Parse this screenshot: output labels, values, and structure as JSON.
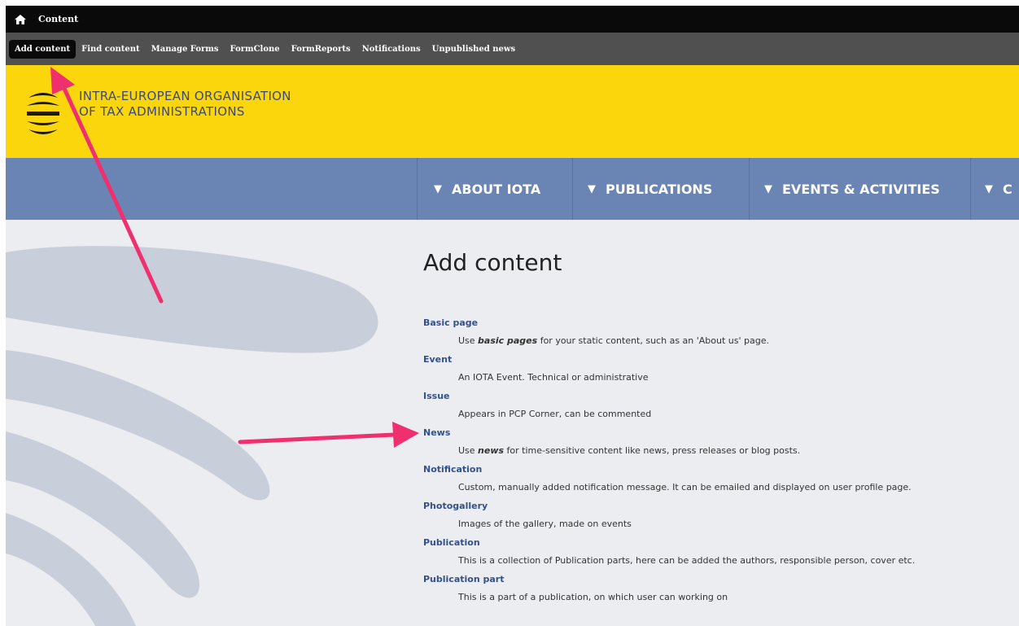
{
  "admin_bar": {
    "home_icon": "home-icon",
    "title": "Content"
  },
  "toolbar": {
    "items": [
      {
        "label": "Add content",
        "active": true
      },
      {
        "label": "Find content"
      },
      {
        "label": "Manage Forms"
      },
      {
        "label": "FormClone"
      },
      {
        "label": "FormReports"
      },
      {
        "label": "Notifications"
      },
      {
        "label": "Unpublished news"
      }
    ]
  },
  "header": {
    "org_line1": "INTRA-EUROPEAN ORGANISATION",
    "org_line2": "OF TAX ADMINISTRATIONS",
    "logo_icon": "iota-logo-icon"
  },
  "nav": {
    "items": [
      {
        "label": "ABOUT IOTA"
      },
      {
        "label": "PUBLICATIONS"
      },
      {
        "label": "EVENTS & ACTIVITIES"
      },
      {
        "label": "C"
      }
    ]
  },
  "page": {
    "title": "Add content",
    "content_types": [
      {
        "name": "Basic page",
        "desc_before": "Use ",
        "desc_em": "basic pages",
        "desc_after": " for your static content, such as an 'About us' page."
      },
      {
        "name": "Event",
        "desc_before": "An IOTA Event. Technical or administrative",
        "desc_em": "",
        "desc_after": ""
      },
      {
        "name": "Issue",
        "desc_before": "Appears in PCP Corner, can be commented",
        "desc_em": "",
        "desc_after": ""
      },
      {
        "name": "News",
        "desc_before": "Use ",
        "desc_em": "news",
        "desc_after": " for time-sensitive content like news, press releases or blog posts."
      },
      {
        "name": "Notification",
        "desc_before": "Custom, manually added notification message. It can be emailed and displayed on user profile page.",
        "desc_em": "",
        "desc_after": ""
      },
      {
        "name": "Photogallery",
        "desc_before": "Images of the gallery, made on events",
        "desc_em": "",
        "desc_after": ""
      },
      {
        "name": "Publication",
        "desc_before": "This is a collection of Publication parts, here can be added the authors, responsible person, cover etc.",
        "desc_em": "",
        "desc_after": ""
      },
      {
        "name": "Publication part",
        "desc_before": "This is a part of a publication, on which user can working on",
        "desc_em": "",
        "desc_after": ""
      }
    ]
  },
  "colors": {
    "header_yellow": "#fcd60c",
    "nav_blue": "#6a84b4",
    "link_blue": "#33518a",
    "arrow_pink": "#f0306e"
  }
}
